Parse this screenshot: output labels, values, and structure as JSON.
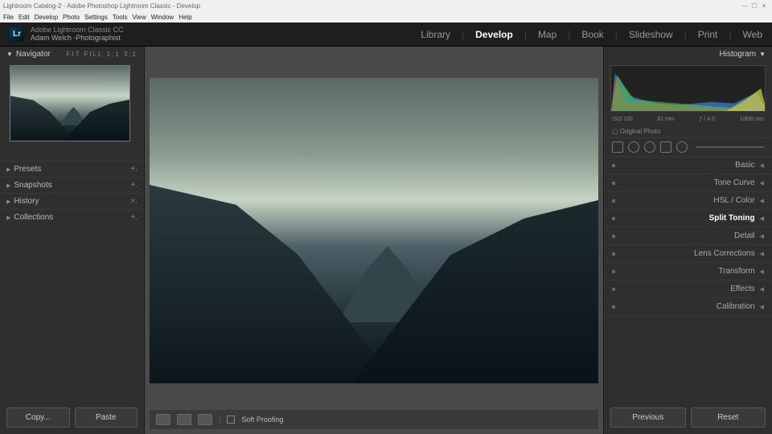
{
  "window": {
    "title": "Lightroom Catalog-2 - Adobe Photoshop Lightroom Classic - Develop"
  },
  "menu": [
    "File",
    "Edit",
    "Develop",
    "Photo",
    "Settings",
    "Tools",
    "View",
    "Window",
    "Help"
  ],
  "identity": {
    "line1": "Adobe Lightroom Classic CC",
    "line2": "Adam Welch -Photographist"
  },
  "modules": [
    "Library",
    "Develop",
    "Map",
    "Book",
    "Slideshow",
    "Print",
    "Web"
  ],
  "active_module": "Develop",
  "navigator": {
    "title": "Navigator",
    "zoom": "FIT  FILL  1:1  3:1"
  },
  "left_sections": [
    {
      "label": "Presets",
      "badge": "+."
    },
    {
      "label": "Snapshots",
      "badge": "+."
    },
    {
      "label": "History",
      "badge": "×."
    },
    {
      "label": "Collections",
      "badge": "+."
    }
  ],
  "buttons": {
    "copy": "Copy...",
    "paste": "Paste",
    "previous": "Previous",
    "reset": "Reset"
  },
  "toolbar": {
    "soft_proof": "Soft Proofing"
  },
  "histogram": {
    "title": "Histogram",
    "iso": "ISO 100",
    "focal": "51 mm",
    "aperture": "ƒ / 4.0",
    "shutter": "1/800 sec",
    "original": "Original Photo"
  },
  "right_panels": [
    "Basic",
    "Tone Curve",
    "HSL / Color",
    "Split Toning",
    "Detail",
    "Lens Corrections",
    "Transform",
    "Effects",
    "Calibration"
  ],
  "active_right_panel": "Split Toning"
}
